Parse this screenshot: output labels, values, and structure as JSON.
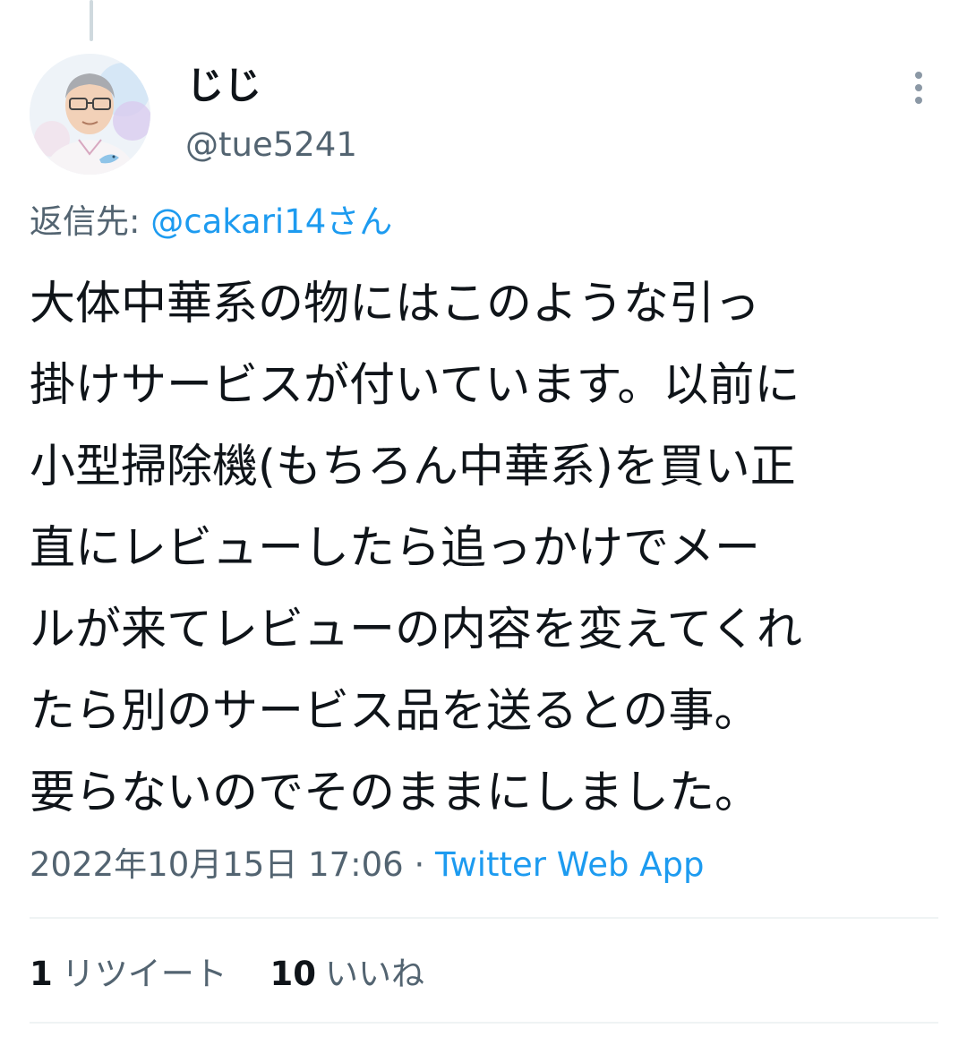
{
  "author": {
    "display_name": "じじ",
    "handle": "@tue5241",
    "avatar_icon": "avatar-illustration-icon"
  },
  "menu": {
    "icon": "more-vertical-icon"
  },
  "reply_to": {
    "label": "返信先: ",
    "mention": "@cakari14さん"
  },
  "tweet": {
    "lines": [
      "大体中華系の物にはこのような引っ",
      "掛けサービスが付いています。以前に",
      "小型掃除機(もちろん中華系)を買い正",
      "直にレビューしたら追っかけでメー",
      "ルが来てレビューの内容を変えてくれ",
      "たら別のサービス品を送るとの事。",
      "要らないのでそのままにしました。"
    ]
  },
  "meta": {
    "timestamp": "2022年10月15日 17:06",
    "separator": " · ",
    "source": "Twitter Web App"
  },
  "stats": {
    "retweets_count": "1",
    "retweets_label": "リツイート",
    "likes_count": "10",
    "likes_label": "いいね"
  },
  "colors": {
    "link": "#1d9bf0",
    "secondary_text": "#536471",
    "primary_text": "#0f1419",
    "divider": "#eff3f4"
  }
}
